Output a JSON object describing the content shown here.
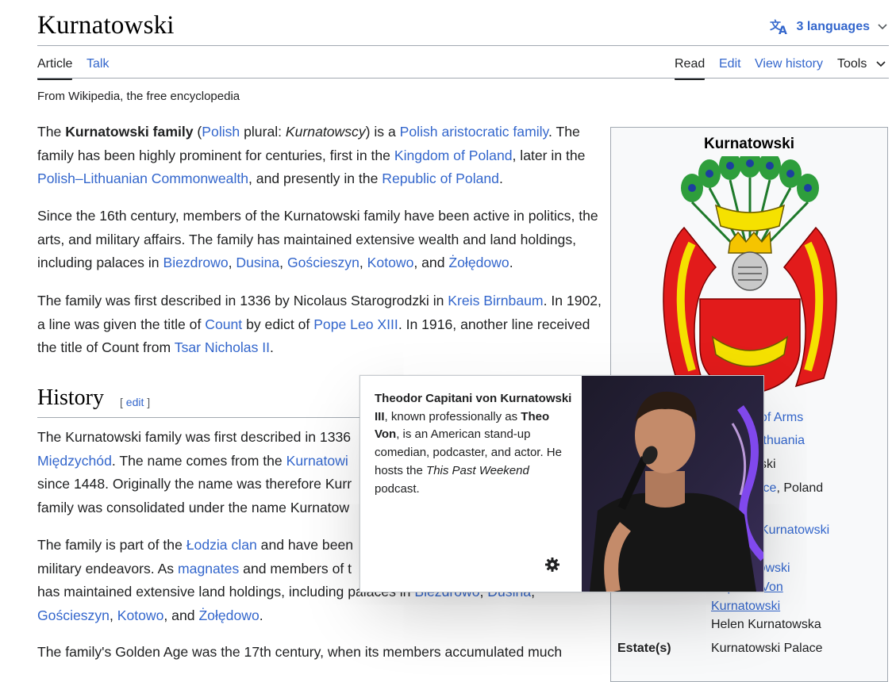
{
  "page": {
    "title": "Kurnatowski",
    "languages_label": "3 languages",
    "tagline": "From Wikipedia, the free encyclopedia"
  },
  "tabs": {
    "article": "Article",
    "talk": "Talk",
    "read": "Read",
    "edit": "Edit",
    "history": "View history",
    "tools": "Tools"
  },
  "paragraphs": {
    "p1": [
      {
        "t": "The "
      },
      {
        "b": "Kurnatowski family"
      },
      {
        "t": " ("
      },
      {
        "l": "Polish"
      },
      {
        "t": " plural: "
      },
      {
        "i": "Kurnatowscy"
      },
      {
        "t": ") is a "
      },
      {
        "l": "Polish aristocratic family"
      },
      {
        "t": ". The family has been highly prominent for centuries, first in the "
      },
      {
        "l": "Kingdom of Poland"
      },
      {
        "t": ", later in the "
      },
      {
        "l": "Polish–Lithuanian Commonwealth"
      },
      {
        "t": ", and presently in the "
      },
      {
        "l": "Republic of Poland"
      },
      {
        "t": "."
      }
    ],
    "p2": [
      {
        "t": "Since the 16th century, members of the Kurnatowski family have been active in politics, the arts, and military affairs. The family has maintained extensive wealth and land holdings, including palaces in "
      },
      {
        "l": "Biezdrowo"
      },
      {
        "t": ", "
      },
      {
        "l": "Dusina"
      },
      {
        "t": ", "
      },
      {
        "l": "Gościeszyn"
      },
      {
        "t": ", "
      },
      {
        "l": "Kotowo"
      },
      {
        "t": ", and "
      },
      {
        "l": "Żołędowo"
      },
      {
        "t": "."
      }
    ],
    "p3": [
      {
        "t": "The family was first described in 1336 by Nicolaus Starogrodzki in "
      },
      {
        "l": "Kreis Birnbaum"
      },
      {
        "t": ". In 1902, a line was given the title of "
      },
      {
        "l": "Count"
      },
      {
        "t": " by edict of "
      },
      {
        "l": "Pope Leo XIII"
      },
      {
        "t": ". In 1916, another line received the title of Count from "
      },
      {
        "l": "Tsar Nicholas II"
      },
      {
        "t": "."
      }
    ],
    "history_heading": "History",
    "history_edit": "edit",
    "p4": [
      {
        "t": "The Kurnatowski family was first described in 1336"
      },
      {
        "br": 1
      },
      {
        "l": "Międzychód"
      },
      {
        "t": ". The name comes from the "
      },
      {
        "l": "Kurnatowi"
      },
      {
        "br": 1
      },
      {
        "t": "since 1448. Originally the name was therefore Kurr"
      },
      {
        "br": 1
      },
      {
        "t": "family was consolidated under the name Kurnatow"
      }
    ],
    "p5": [
      {
        "t": "The family is part of the "
      },
      {
        "l": "Łodzia clan"
      },
      {
        "t": " and have been"
      },
      {
        "br": 1
      },
      {
        "t": "military endeavors. As "
      },
      {
        "l": "magnates"
      },
      {
        "t": " and members of t"
      },
      {
        "br": 1
      },
      {
        "t": "has maintained extensive land holdings, including palaces in "
      },
      {
        "l": "Biezdrowo"
      },
      {
        "t": ", "
      },
      {
        "l": "Dusina"
      },
      {
        "t": ","
      },
      {
        "br": 1
      },
      {
        "l": "Gościeszyn"
      },
      {
        "t": ", "
      },
      {
        "l": "Kotowo"
      },
      {
        "t": ", and "
      },
      {
        "l": "Żołędowo"
      },
      {
        "t": "."
      }
    ],
    "p6": [
      {
        "t": "The family's Golden Age was the 17th century, when its members accumulated much"
      }
    ]
  },
  "infobox": {
    "title": "Kurnatowski",
    "lines": [
      {
        "kind": "link",
        "text": "of Arms"
      },
      {
        "kind": "link",
        "text": "ithuania"
      },
      {
        "kind": "text",
        "text": "ski"
      },
      {
        "kind": "mixed",
        "link": "ice",
        "text": ", Poland"
      },
      {
        "kind": "link",
        "text": "Kurnatowski"
      },
      {
        "kind": "link",
        "text": "natowski"
      },
      {
        "kind": "link",
        "text": "y Kurnatowski"
      },
      {
        "kind": "link",
        "text": "Capitani Von"
      },
      {
        "kind": "link",
        "text": "Kurnatowski"
      },
      {
        "kind": "text",
        "text": "Helen Kurnatowska"
      }
    ],
    "estate_label": "Estate(s)",
    "estate_value": "Kurnatowski Palace"
  },
  "popup": {
    "name_bold": "Theodor Capitani von Kurnatowski III",
    "text1": ", known professionally as ",
    "stage_name": "Theo Von",
    "text2": ", is an American stand-up comedian, podcaster, and actor. He hosts the ",
    "podcast": "This Past Weekend",
    "text3": " podcast."
  },
  "colors": {
    "link": "#3366cc",
    "text": "#202122",
    "border": "#a2a9b1",
    "infobox_bg": "#f8f9fa"
  }
}
